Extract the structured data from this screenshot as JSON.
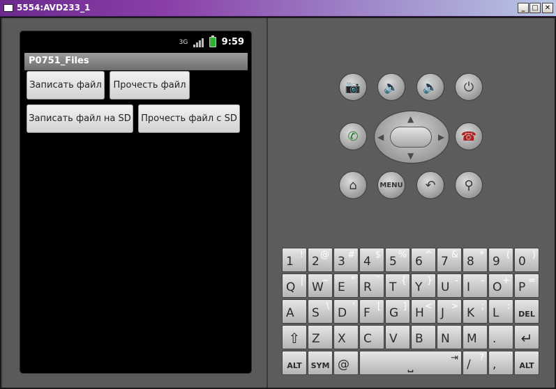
{
  "window": {
    "title": "5554:AVD233_1",
    "min_label": "_",
    "max_label": "□",
    "close_label": "✕"
  },
  "status_bar": {
    "network_label": "3G",
    "time": "9:59"
  },
  "app": {
    "title": "P0751_Files",
    "buttons": {
      "write_file": "Записать файл",
      "read_file": "Прочесть файл",
      "write_sd": "Записать файл на SD",
      "read_sd": "Прочесть файл с SD"
    }
  },
  "hardware": {
    "camera_icon": "📷",
    "vol_down_icon": "🔉",
    "vol_up_icon": "🔊",
    "power_icon": "⏻",
    "call_icon": "✆",
    "end_call_icon": "☎",
    "home_icon": "⌂",
    "menu_label": "MENU",
    "back_icon": "↶",
    "search_icon": "⚲",
    "dpad_up": "▲",
    "dpad_down": "▼",
    "dpad_left": "◀",
    "dpad_right": "▶"
  },
  "keyboard": {
    "row1": [
      {
        "main": "1",
        "alt": "!"
      },
      {
        "main": "2",
        "alt": "@"
      },
      {
        "main": "3",
        "alt": "#"
      },
      {
        "main": "4",
        "alt": "$"
      },
      {
        "main": "5",
        "alt": "%"
      },
      {
        "main": "6",
        "alt": "^"
      },
      {
        "main": "7",
        "alt": "&"
      },
      {
        "main": "8",
        "alt": "*"
      },
      {
        "main": "9",
        "alt": "("
      },
      {
        "main": "0",
        "alt": ")"
      }
    ],
    "row2": [
      {
        "main": "Q",
        "alt": "|"
      },
      {
        "main": "W",
        "alt": "~"
      },
      {
        "main": "E",
        "alt": "\""
      },
      {
        "main": "R",
        "alt": "`"
      },
      {
        "main": "T",
        "alt": "{"
      },
      {
        "main": "Y",
        "alt": "}"
      },
      {
        "main": "U",
        "alt": "-"
      },
      {
        "main": "I",
        "alt": "-"
      },
      {
        "main": "O",
        "alt": "+"
      },
      {
        "main": "P",
        "alt": "="
      }
    ],
    "row3": [
      {
        "main": "A",
        "alt": ""
      },
      {
        "main": "S",
        "alt": "\\"
      },
      {
        "main": "D",
        "alt": "'"
      },
      {
        "main": "F",
        "alt": "["
      },
      {
        "main": "G",
        "alt": "]"
      },
      {
        "main": "H",
        "alt": "<"
      },
      {
        "main": "J",
        "alt": ">"
      },
      {
        "main": "K",
        "alt": ";"
      },
      {
        "main": "L",
        "alt": ":"
      },
      {
        "main": "DEL",
        "alt": ""
      }
    ],
    "row4": [
      {
        "main": "⇧",
        "alt": ""
      },
      {
        "main": "Z",
        "alt": ""
      },
      {
        "main": "X",
        "alt": ""
      },
      {
        "main": "C",
        "alt": ""
      },
      {
        "main": "V",
        "alt": ""
      },
      {
        "main": "B",
        "alt": ""
      },
      {
        "main": "N",
        "alt": ""
      },
      {
        "main": "M",
        "alt": ""
      },
      {
        "main": ".",
        "alt": ""
      },
      {
        "main": "↵",
        "alt": ""
      }
    ],
    "row5": [
      {
        "main": "ALT",
        "alt": ""
      },
      {
        "main": "SYM",
        "alt": ""
      },
      {
        "main": "@",
        "alt": ""
      },
      {
        "main": "⎵",
        "alt": "⇥"
      },
      {
        "main": "/",
        "alt": "?"
      },
      {
        "main": ",",
        "alt": ""
      },
      {
        "main": "ALT",
        "alt": ""
      }
    ]
  }
}
